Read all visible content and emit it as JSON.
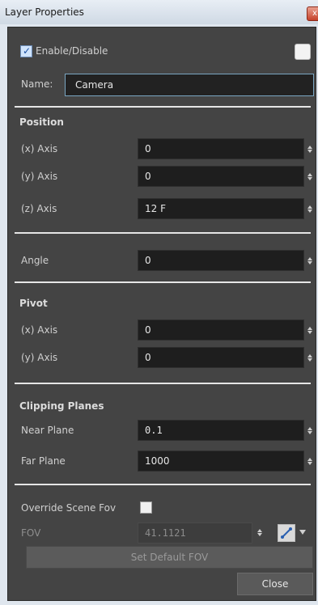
{
  "window": {
    "title": "Layer Properties",
    "close_icon": "close-icon"
  },
  "enable": {
    "label": "Enable/Disable",
    "checked": true
  },
  "name": {
    "label": "Name:",
    "value": "Camera"
  },
  "position": {
    "title": "Position",
    "x": {
      "label": "(x) Axis",
      "value": "0"
    },
    "y": {
      "label": "(y) Axis",
      "value": "0"
    },
    "z": {
      "label": "(z) Axis",
      "value": "12 F"
    }
  },
  "angle": {
    "label": "Angle",
    "value": "0"
  },
  "pivot": {
    "title": "Pivot",
    "x": {
      "label": "(x) Axis",
      "value": "0"
    },
    "y": {
      "label": "(y) Axis",
      "value": "0"
    }
  },
  "clipping": {
    "title": "Clipping Planes",
    "near": {
      "label": "Near Plane",
      "value": "0.1"
    },
    "far": {
      "label": "Far Plane",
      "value": "1000"
    }
  },
  "fov": {
    "override_label": "Override Scene Fov",
    "override_checked": false,
    "label": "FOV",
    "value": "41.1121",
    "set_default_label": "Set Default FOV"
  },
  "footer": {
    "close_label": "Close"
  }
}
